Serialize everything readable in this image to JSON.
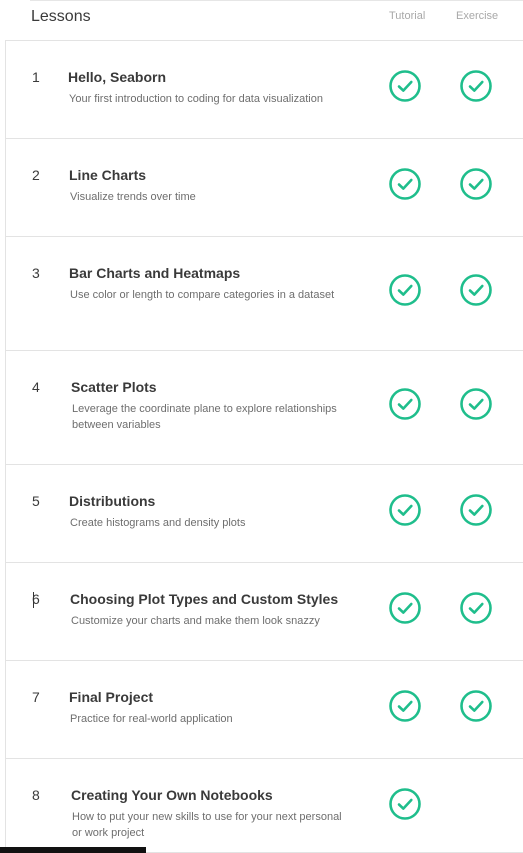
{
  "header": {
    "title": "Lessons",
    "col_tutorial": "Tutorial",
    "col_exercise": "Exercise"
  },
  "colors": {
    "check": "#1fbe8c",
    "divider": "#e3e3e3",
    "title": "#3a3a3a",
    "description": "#6e6e6e",
    "column_header": "#a8a8a8"
  },
  "icons": {
    "completed": "checkmark-circle-icon"
  },
  "lessons": [
    {
      "number": "1",
      "title": "Hello, Seaborn",
      "description": "Your first introduction to coding for data visualization",
      "tutorial_done": true,
      "exercise_done": true
    },
    {
      "number": "2",
      "title": "Line Charts",
      "description": "Visualize trends over time",
      "tutorial_done": true,
      "exercise_done": true
    },
    {
      "number": "3",
      "title": "Bar Charts and Heatmaps",
      "description": "Use color or length to compare categories in a dataset",
      "tutorial_done": true,
      "exercise_done": true
    },
    {
      "number": "4",
      "title": "Scatter Plots",
      "description": "Leverage the coordinate plane to explore relationships between variables",
      "tutorial_done": true,
      "exercise_done": true
    },
    {
      "number": "5",
      "title": "Distributions",
      "description": "Create histograms and density plots",
      "tutorial_done": true,
      "exercise_done": true
    },
    {
      "number": "6",
      "title": "Choosing Plot Types and Custom Styles",
      "description": "Customize your charts and make them look snazzy",
      "tutorial_done": true,
      "exercise_done": true
    },
    {
      "number": "7",
      "title": "Final Project",
      "description": "Practice for real-world application",
      "tutorial_done": true,
      "exercise_done": true
    },
    {
      "number": "8",
      "title": "Creating Your Own Notebooks",
      "description": "How to put your new skills to use for your next personal or work project",
      "tutorial_done": true,
      "exercise_done": false
    }
  ]
}
